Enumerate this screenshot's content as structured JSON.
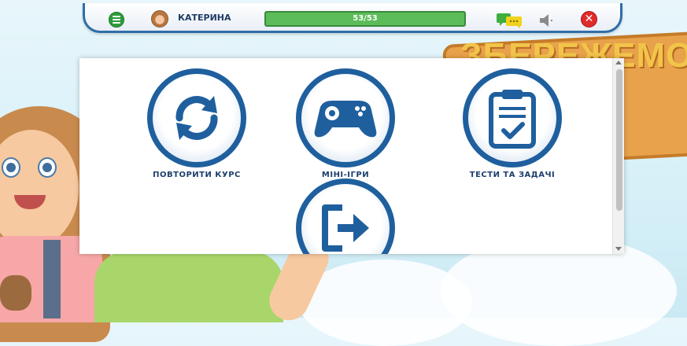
{
  "header": {
    "username": "КАТЕРИНА",
    "progress_text": "53/53",
    "progress_value": 1.0
  },
  "icons": {
    "menu": "menu-icon",
    "avatar": "avatar",
    "chat": "chat-icon",
    "sound": "speaker-icon",
    "close": "close-icon"
  },
  "menu_tiles": [
    {
      "label": "ПОВТОРИТИ КУРС",
      "icon": "refresh-icon"
    },
    {
      "label": "МІНІ-ІГРИ",
      "icon": "gamepad-icon"
    },
    {
      "label": "ТЕСТИ ТА ЗАДАЧІ",
      "icon": "clipboard-check-icon"
    },
    {
      "label": "",
      "icon": "exit-icon"
    }
  ],
  "background": {
    "sign_text": "ЗБЕРЕЖЕМО\nЗЕМЛЮ"
  },
  "colors": {
    "accent_blue": "#1f5f9e",
    "progress_green": "#5cbc5a",
    "close_red": "#e02b2b",
    "menu_green": "#2e9c3a",
    "chat_yellow": "#f2d21a"
  }
}
